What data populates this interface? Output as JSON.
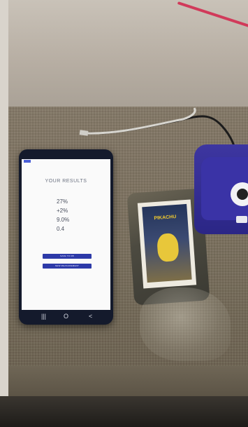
{
  "phone_screen": {
    "title": "YOUR RESULTS",
    "values": [
      "27%",
      "+2%",
      "9.0%",
      "0.4"
    ],
    "buttons": [
      "SAVE TO DB",
      "NEW MEASUREMENT"
    ],
    "nav": [
      "|||",
      "O",
      "<"
    ]
  },
  "card": {
    "title": "PIKACHU"
  },
  "colors": {
    "button": "#2d3aa8",
    "device": "#3d36a0",
    "phone_body": "#141a2c"
  }
}
